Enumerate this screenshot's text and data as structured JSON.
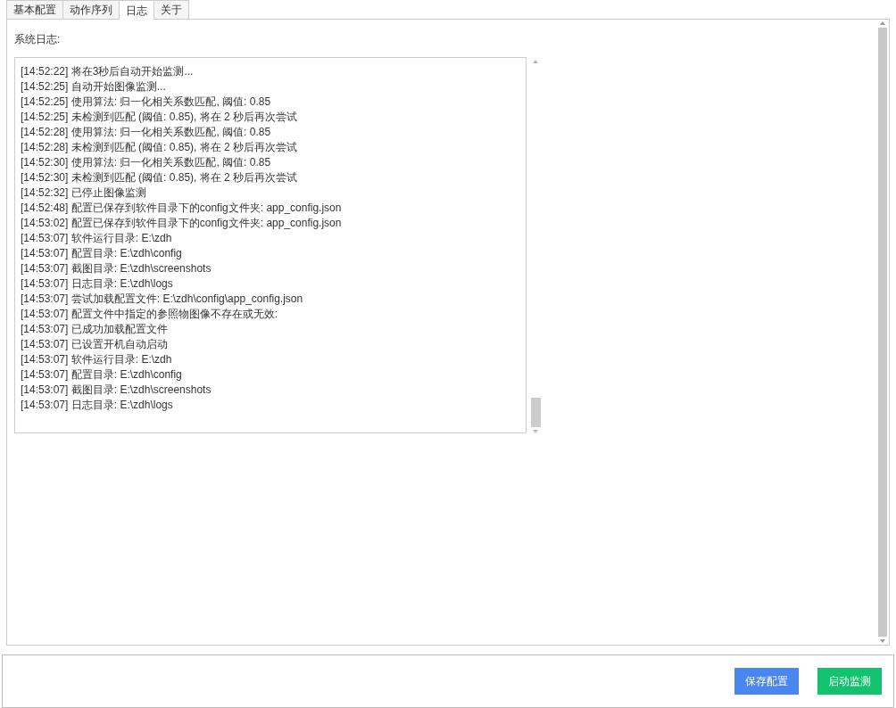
{
  "tabs": [
    {
      "label": "基本配置",
      "selected": false
    },
    {
      "label": "动作序列",
      "selected": false
    },
    {
      "label": "日志",
      "selected": true
    },
    {
      "label": "关于",
      "selected": false
    }
  ],
  "log_panel": {
    "label": "系统日志:",
    "lines": [
      "[14:52:22] 将在3秒后自动开始监测...",
      "[14:52:25] 自动开始图像监测...",
      "[14:52:25] 使用算法: 归一化相关系数匹配, 阈值: 0.85",
      "[14:52:25] 未检测到匹配 (阈值: 0.85), 将在 2 秒后再次尝试",
      "[14:52:28] 使用算法: 归一化相关系数匹配, 阈值: 0.85",
      "[14:52:28] 未检测到匹配 (阈值: 0.85), 将在 2 秒后再次尝试",
      "[14:52:30] 使用算法: 归一化相关系数匹配, 阈值: 0.85",
      "[14:52:30] 未检测到匹配 (阈值: 0.85), 将在 2 秒后再次尝试",
      "[14:52:32] 已停止图像监测",
      "[14:52:48] 配置已保存到软件目录下的config文件夹: app_config.json",
      "[14:53:02] 配置已保存到软件目录下的config文件夹: app_config.json",
      "[14:53:07] 软件运行目录: E:\\zdh",
      "[14:53:07] 配置目录: E:\\zdh\\config",
      "[14:53:07] 截图目录: E:\\zdh\\screenshots",
      "[14:53:07] 日志目录: E:\\zdh\\logs",
      "[14:53:07] 尝试加载配置文件: E:\\zdh\\config\\app_config.json",
      "[14:53:07] 配置文件中指定的参照物图像不存在或无效:",
      "[14:53:07] 已成功加载配置文件",
      "[14:53:07] 已设置开机自动启动",
      "[14:53:07] 软件运行目录: E:\\zdh",
      "[14:53:07] 配置目录: E:\\zdh\\config",
      "[14:53:07] 截图目录: E:\\zdh\\screenshots",
      "[14:53:07] 日志目录: E:\\zdh\\logs"
    ]
  },
  "buttons": [
    {
      "label": "保存配置",
      "kind": "primary"
    },
    {
      "label": "启动监测",
      "kind": "success"
    }
  ]
}
